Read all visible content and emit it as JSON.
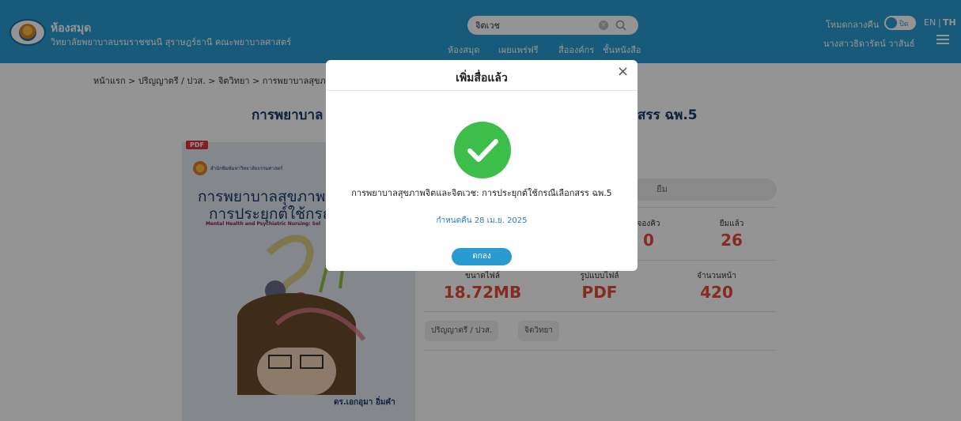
{
  "header": {
    "library_title": "ห้องสมุด",
    "library_subtitle": "วิทยาลัยพยาบาลบรมราชชนนี สุราษฎร์ธานี คณะพยาบาลศาสตร์",
    "search": {
      "value": "จิตเวช",
      "placeholder": ""
    },
    "nav": [
      "ห้องสมุด",
      "เผยแพร่ฟรี",
      "สื่อองค์กร",
      "ชั้นหนังสือ"
    ],
    "timeout_label": "โหมดกลางคืน",
    "toggle_text": "ปิด",
    "lang_en": "EN",
    "lang_sep": "|",
    "lang_th": "TH",
    "user_name": "นางสาวธิดารัตน์ วาสันธ์"
  },
  "breadcrumb": "หน้าแรก > ปริญญาตรี / ปวส. > จิตวิทยา > การพยาบาลสุขภาพ",
  "page_title_left": "การพยาบาล",
  "page_title_right": "สรร ฉพ.5",
  "cover": {
    "badge": "PDF",
    "org": "สำนักพิมพ์มหาวิทยาลัยธรรมศาสตร์",
    "title_line1": "การพยาบาลสุขภาพจิต",
    "title_line2": "การประยุกต์ใช้กรณี",
    "english": "Mental Health and Psychiatric Nursing: Sel",
    "author": "ดร.เอกอุมา อิ่มคำ"
  },
  "details": {
    "borrow_label": "ยืม",
    "stats_top": [
      {
        "label": "จองคิว",
        "value": "0"
      },
      {
        "label": "ยืมแล้ว",
        "value": "26"
      }
    ],
    "stats_bottom": [
      {
        "label": "ขนาดไฟล์",
        "value": "18.72MB"
      },
      {
        "label": "รูปแบบไฟล์",
        "value": "PDF"
      },
      {
        "label": "จำนวนหน้า",
        "value": "420"
      }
    ],
    "tags": [
      "ปริญญาตรี / ปวส.",
      "จิตวิทยา"
    ]
  },
  "modal": {
    "title": "เพิ่มสื่อแล้ว",
    "close_symbol": "×",
    "book_title": "การพยาบาลสุขภาพจิตและจิตเวช: การประยุกต์ใช้กรณีเลือกสรร ฉพ.5",
    "due": "กำหนดคืน 28 เม.ย. 2025",
    "ok_label": "ตกลง"
  },
  "colors": {
    "header_bg": "#2a9bd1",
    "accent_red": "#e54b3c",
    "check_green": "#3dbe4a",
    "title_navy": "#1b3a6b"
  },
  "icons": [
    "logo-icon",
    "search-icon",
    "clear-icon",
    "menu-icon",
    "close-icon",
    "check-icon"
  ]
}
